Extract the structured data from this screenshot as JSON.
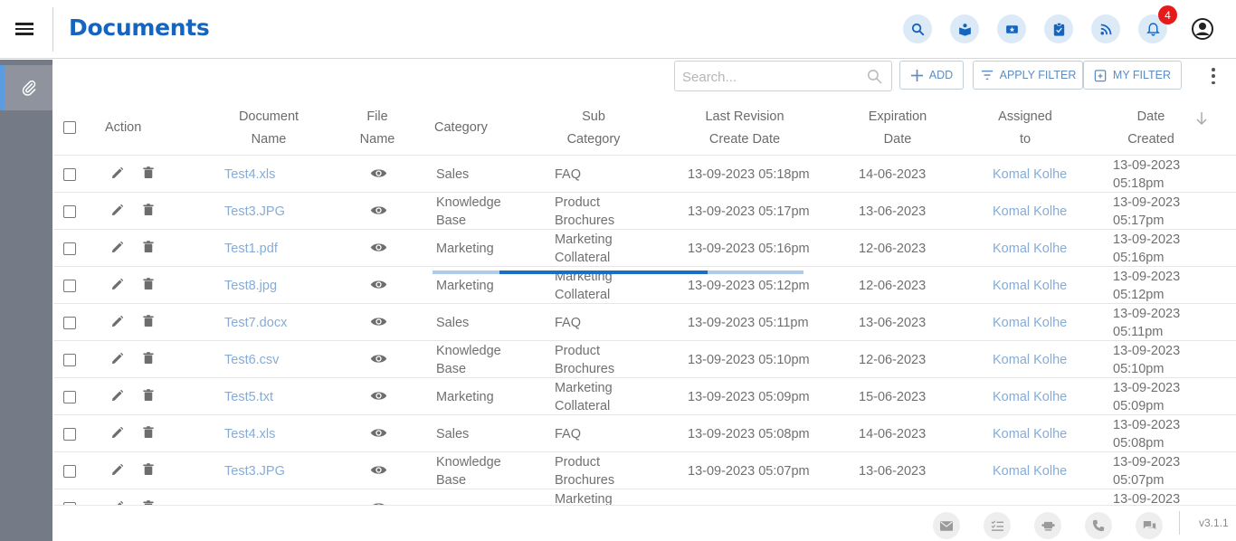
{
  "app": {
    "title": "Documents",
    "notification_count": "4",
    "version": "v3.1.1"
  },
  "colors": {
    "brand_blue": "#1565c0",
    "link": "#86acd6",
    "sidebar": "#757a87",
    "badge": "#e31b1b"
  },
  "header_icons": [
    "search-icon",
    "knowledge-icon",
    "ticket-icon",
    "task-icon",
    "feed-icon",
    "bell-icon"
  ],
  "toolbar": {
    "search_placeholder": "Search...",
    "add_label": "ADD",
    "apply_filter_label": "APPLY FILTER",
    "my_filter_label": "MY FILTER"
  },
  "columns": {
    "action": "Action",
    "document_name": [
      "Document",
      "Name"
    ],
    "file_name": [
      "File",
      "Name"
    ],
    "category": "Category",
    "sub_category": [
      "Sub",
      "Category"
    ],
    "last_revision": [
      "Last Revision",
      "Create Date"
    ],
    "expiration": [
      "Expiration",
      "Date"
    ],
    "assigned": [
      "Assigned",
      "to"
    ],
    "date_created": [
      "Date",
      "Created"
    ]
  },
  "rows": [
    {
      "doc": "Test4.xls",
      "cat": [
        "Sales"
      ],
      "sub": [
        "FAQ"
      ],
      "rev": "13-09-2023 05:18pm",
      "exp": "14-06-2023",
      "assigned": "Komal Kolhe",
      "created": [
        "13-09-2023",
        "05:18pm"
      ]
    },
    {
      "doc": "Test3.JPG",
      "cat": [
        "Knowledge",
        "Base"
      ],
      "sub": [
        "Product",
        "Brochures"
      ],
      "rev": "13-09-2023 05:17pm",
      "exp": "13-06-2023",
      "assigned": "Komal Kolhe",
      "created": [
        "13-09-2023",
        "05:17pm"
      ]
    },
    {
      "doc": "Test1.pdf",
      "cat": [
        "Marketing"
      ],
      "sub": [
        "Marketing",
        "Collateral"
      ],
      "rev": "13-09-2023 05:16pm",
      "exp": "12-06-2023",
      "assigned": "Komal Kolhe",
      "created": [
        "13-09-2023",
        "05:16pm"
      ]
    },
    {
      "doc": "Test8.jpg",
      "cat": [
        "Marketing"
      ],
      "sub": [
        "Marketing",
        "Collateral"
      ],
      "rev": "13-09-2023 05:12pm",
      "exp": "12-06-2023",
      "assigned": "Komal Kolhe",
      "created": [
        "13-09-2023",
        "05:12pm"
      ]
    },
    {
      "doc": "Test7.docx",
      "cat": [
        "Sales"
      ],
      "sub": [
        "FAQ"
      ],
      "rev": "13-09-2023 05:11pm",
      "exp": "13-06-2023",
      "assigned": "Komal Kolhe",
      "created": [
        "13-09-2023",
        "05:11pm"
      ]
    },
    {
      "doc": "Test6.csv",
      "cat": [
        "Knowledge",
        "Base"
      ],
      "sub": [
        "Product",
        "Brochures"
      ],
      "rev": "13-09-2023 05:10pm",
      "exp": "12-06-2023",
      "assigned": "Komal Kolhe",
      "created": [
        "13-09-2023",
        "05:10pm"
      ]
    },
    {
      "doc": "Test5.txt",
      "cat": [
        "Marketing"
      ],
      "sub": [
        "Marketing",
        "Collateral"
      ],
      "rev": "13-09-2023 05:09pm",
      "exp": "15-06-2023",
      "assigned": "Komal Kolhe",
      "created": [
        "13-09-2023",
        "05:09pm"
      ]
    },
    {
      "doc": "Test4.xls",
      "cat": [
        "Sales"
      ],
      "sub": [
        "FAQ"
      ],
      "rev": "13-09-2023 05:08pm",
      "exp": "14-06-2023",
      "assigned": "Komal Kolhe",
      "created": [
        "13-09-2023",
        "05:08pm"
      ]
    },
    {
      "doc": "Test3.JPG",
      "cat": [
        "Knowledge",
        "Base"
      ],
      "sub": [
        "Product",
        "Brochures"
      ],
      "rev": "13-09-2023 05:07pm",
      "exp": "13-06-2023",
      "assigned": "Komal Kolhe",
      "created": [
        "13-09-2023",
        "05:07pm"
      ]
    },
    {
      "doc": "",
      "cat": [],
      "sub": [
        "Marketing"
      ],
      "rev": "",
      "exp": "",
      "assigned": "",
      "created": [
        "13-09-2023"
      ]
    }
  ],
  "progress": {
    "start_fraction": 0.18,
    "end_fraction": 0.74
  },
  "footer_icons": [
    "mail-icon",
    "checklist-icon",
    "meeting-icon",
    "phone-icon",
    "chat-icon"
  ]
}
